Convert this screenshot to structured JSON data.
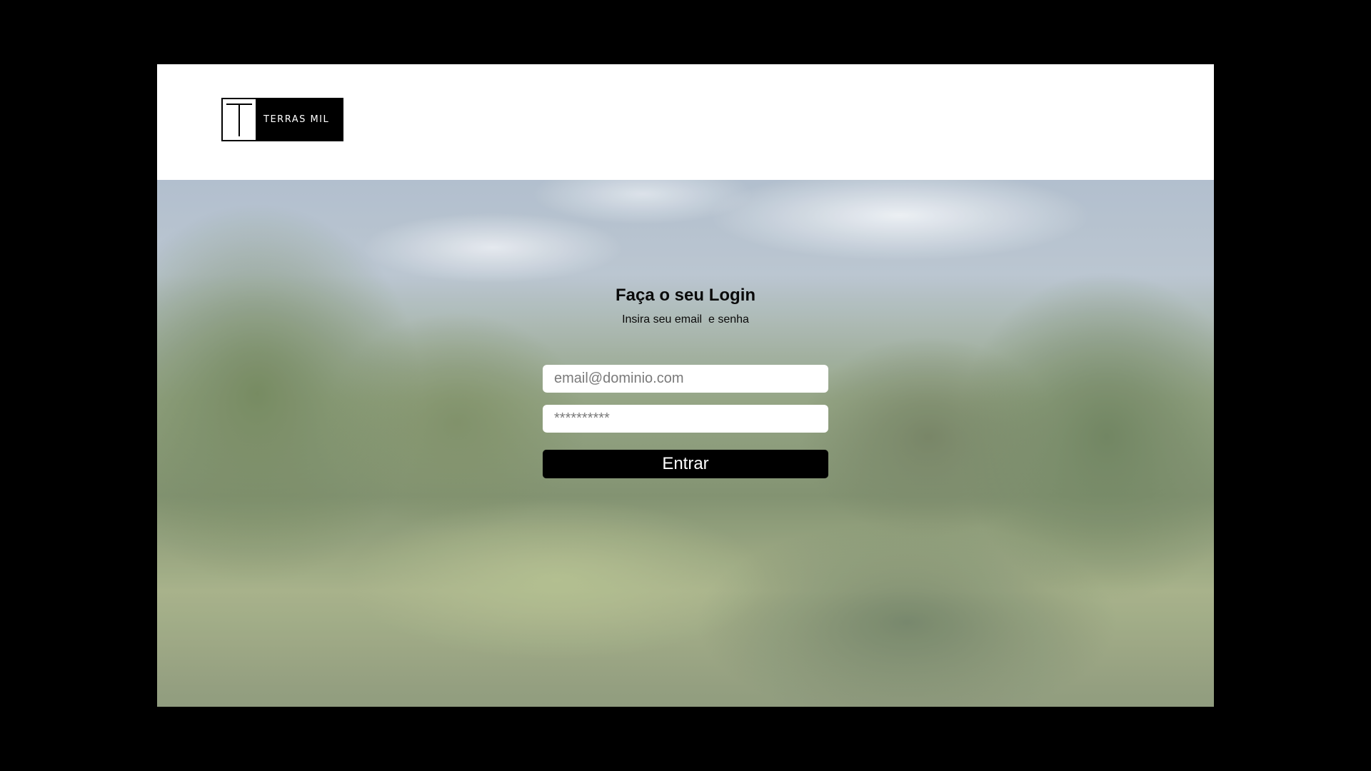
{
  "brand": {
    "logo_text": "TERRAS MIL",
    "logo_letter": "T"
  },
  "login": {
    "title": "Faça o seu Login",
    "subtitle": "Insira seu email  e senha",
    "email_placeholder": "email@dominio.com",
    "password_placeholder": "**********",
    "submit_label": "Entrar"
  },
  "colors": {
    "page_background": "#000000",
    "header_background": "#ffffff",
    "button_background": "#000000",
    "button_text": "#ffffff"
  }
}
